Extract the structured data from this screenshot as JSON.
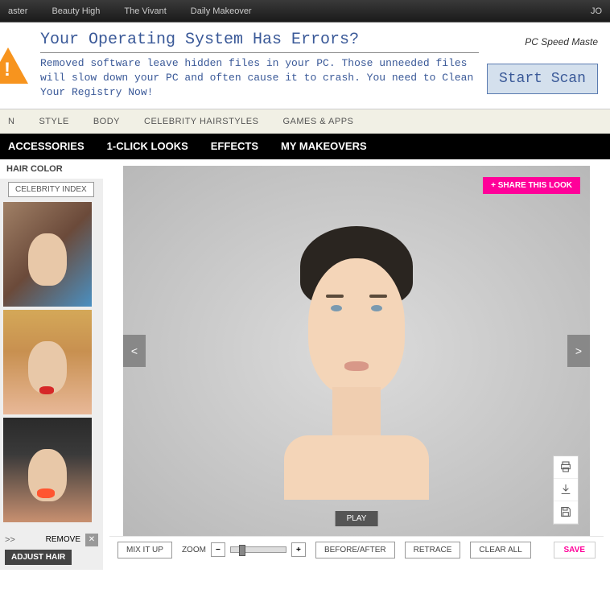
{
  "topbar": {
    "links": [
      "aster",
      "Beauty High",
      "The Vivant",
      "Daily Makeover"
    ],
    "right": "JO"
  },
  "ad": {
    "title": "Your Operating System Has Errors?",
    "body": "Removed software leave hidden files in your PC. Those unneeded files will slow down your PC and often cause it to crash. You need to Clean Your Registry Now!",
    "brand": "PC Speed Maste",
    "button": "Start Scan"
  },
  "nav1": {
    "items": [
      "N",
      "STYLE",
      "BODY",
      "CELEBRITY HAIRSTYLES",
      "GAMES & APPS"
    ]
  },
  "nav2": {
    "items": [
      "ACCESSORIES",
      "1-CLICK LOOKS",
      "EFFECTS",
      "MY MAKEOVERS"
    ]
  },
  "sidebar": {
    "header": "HAIR COLOR",
    "celebrity_index": "CELEBRITY INDEX",
    "arrows": ">>",
    "remove": "REMOVE",
    "adjust": "ADJUST HAIR"
  },
  "canvas": {
    "share": "+ SHARE THIS LOOK",
    "prev": "<",
    "next": ">",
    "play": "PLAY"
  },
  "controls": {
    "mix": "MIX IT UP",
    "zoom": "ZOOM",
    "minus": "−",
    "plus": "+",
    "before_after": "BEFORE/AFTER",
    "retrace": "RETRACE",
    "clear": "CLEAR ALL",
    "save": "SAVE"
  }
}
